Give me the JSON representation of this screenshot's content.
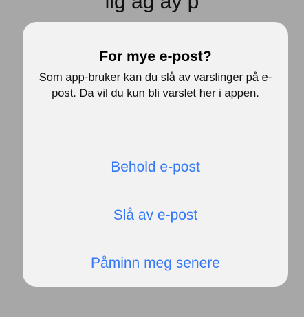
{
  "backdrop": {
    "partial_text": "lig ag  ay  p"
  },
  "alert": {
    "title": "For mye e-post?",
    "message": "Som app-bruker kan du slå av varslinger på e-post. Da vil du kun bli varslet her i appen.",
    "buttons": [
      {
        "label": "Behold e-post"
      },
      {
        "label": "Slå av e-post"
      },
      {
        "label": "Påminn meg senere"
      }
    ]
  },
  "colors": {
    "accent": "#3478f6",
    "dialog_background": "#f2f2f2",
    "dimmed_backdrop": "#a7a7a7",
    "separator": "#c6c6c8"
  }
}
